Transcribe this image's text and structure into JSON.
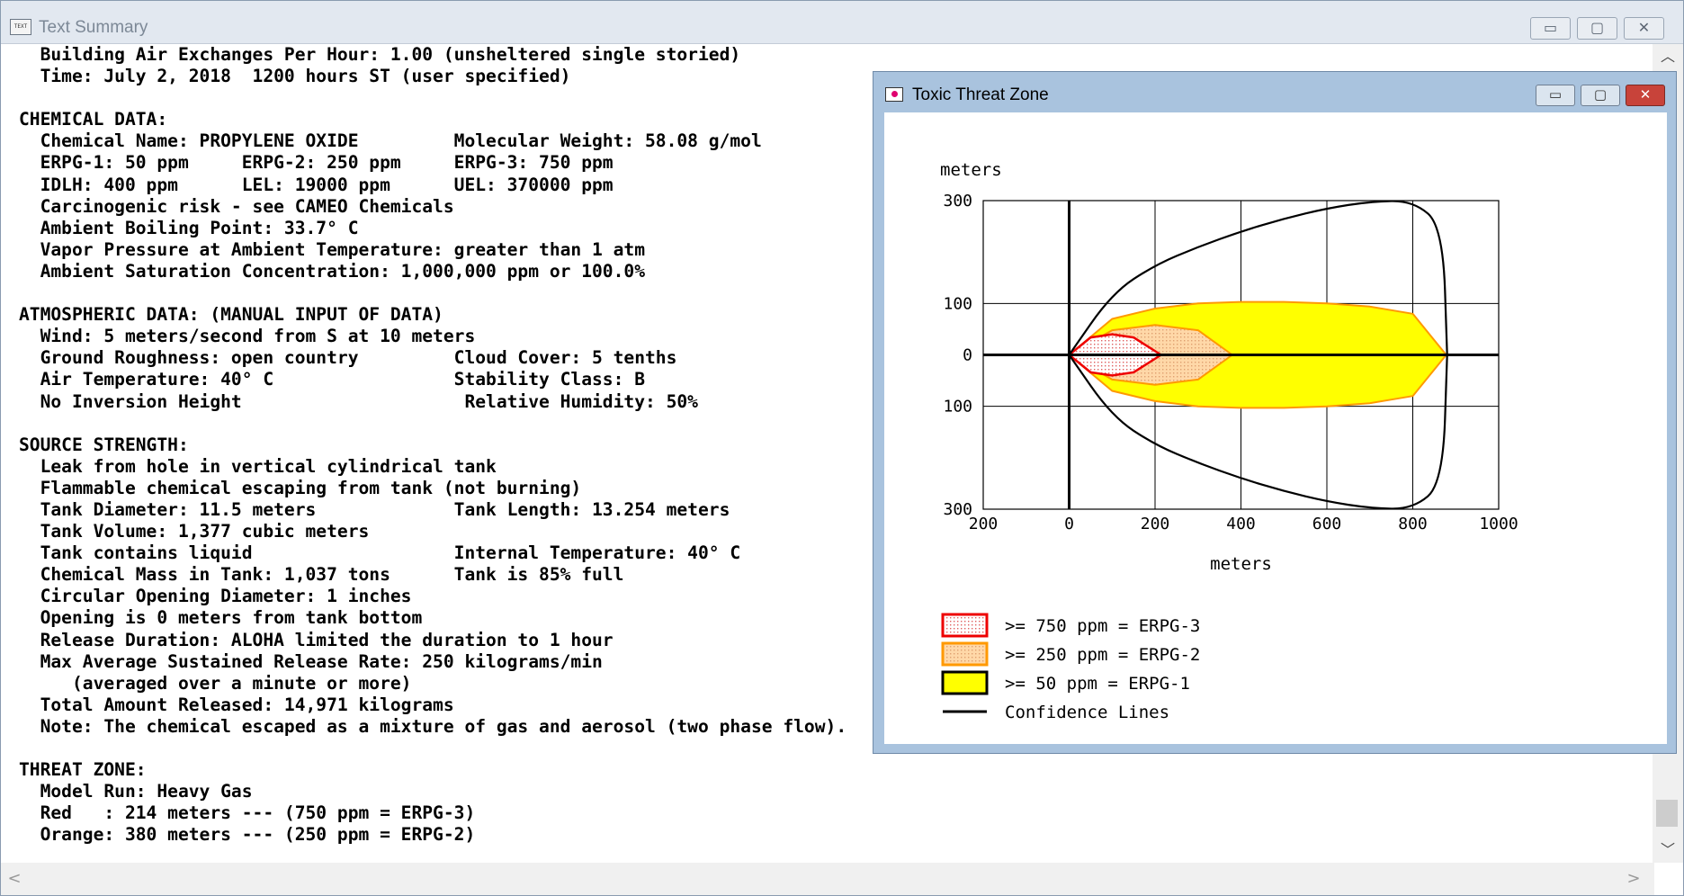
{
  "main_window": {
    "title": "Text Summary",
    "icon_label": "TEXT",
    "controls": {
      "minimize": "▭",
      "maximize": "▢",
      "close": "✕"
    },
    "lines": [
      "  Building Air Exchanges Per Hour: 1.00 (unsheltered single storied)",
      "  Time: July 2, 2018  1200 hours ST (user specified)",
      "",
      "CHEMICAL DATA:",
      "  Chemical Name: PROPYLENE OXIDE         Molecular Weight: 58.08 g/mol",
      "  ERPG-1: 50 ppm     ERPG-2: 250 ppm     ERPG-3: 750 ppm",
      "  IDLH: 400 ppm      LEL: 19000 ppm      UEL: 370000 ppm",
      "  Carcinogenic risk - see CAMEO Chemicals",
      "  Ambient Boiling Point: 33.7° C",
      "  Vapor Pressure at Ambient Temperature: greater than 1 atm",
      "  Ambient Saturation Concentration: 1,000,000 ppm or 100.0%",
      "",
      "ATMOSPHERIC DATA: (MANUAL INPUT OF DATA)",
      "  Wind: 5 meters/second from S at 10 meters",
      "  Ground Roughness: open country         Cloud Cover: 5 tenths",
      "  Air Temperature: 40° C                 Stability Class: B",
      "  No Inversion Height                     Relative Humidity: 50%",
      "",
      "SOURCE STRENGTH:",
      "  Leak from hole in vertical cylindrical tank",
      "  Flammable chemical escaping from tank (not burning)",
      "  Tank Diameter: 11.5 meters             Tank Length: 13.254 meters",
      "  Tank Volume: 1,377 cubic meters",
      "  Tank contains liquid                   Internal Temperature: 40° C",
      "  Chemical Mass in Tank: 1,037 tons      Tank is 85% full",
      "  Circular Opening Diameter: 1 inches",
      "  Opening is 0 meters from tank bottom",
      "  Release Duration: ALOHA limited the duration to 1 hour",
      "  Max Average Sustained Release Rate: 250 kilograms/min",
      "     (averaged over a minute or more)",
      "  Total Amount Released: 14,971 kilograms",
      "  Note: The chemical escaped as a mixture of gas and aerosol (two phase flow).",
      "",
      "THREAT ZONE:",
      "  Model Run: Heavy Gas",
      "  Red   : 214 meters --- (750 ppm = ERPG-3)",
      "  Orange: 380 meters --- (250 ppm = ERPG-2)"
    ]
  },
  "threat_window": {
    "title": "Toxic Threat Zone",
    "controls": {
      "minimize": "▭",
      "maximize": "▢",
      "close": "✕"
    }
  },
  "chart_data": {
    "type": "area",
    "ylabel": "meters",
    "xlabel": "meters",
    "x_ticks": [
      "200",
      "0",
      "200",
      "400",
      "600",
      "800",
      "1000"
    ],
    "y_ticks": [
      "300",
      "100",
      "0",
      "100",
      "300"
    ],
    "xlim": [
      -200,
      1000
    ],
    "ylim": [
      -300,
      300
    ],
    "grid": true,
    "legend_placement": "bottom-left",
    "series": [
      {
        "name": ">= 50 ppm = ERPG-1",
        "color": "#ffff00",
        "edge": "#ff9900",
        "x": [
          0,
          100,
          200,
          300,
          400,
          500,
          600,
          700,
          800,
          878
        ],
        "y_halfwidth": [
          0,
          70,
          90,
          100,
          103,
          103,
          100,
          94,
          80,
          0
        ]
      },
      {
        "name": ">= 250 ppm = ERPG-2",
        "color": "#ffd8a8",
        "edge": "#ff9900",
        "x": [
          0,
          100,
          200,
          300,
          380
        ],
        "y_halfwidth": [
          0,
          48,
          58,
          48,
          0
        ]
      },
      {
        "name": ">= 750 ppm = ERPG-3",
        "color": "#ffffff",
        "edge": "#ee0000",
        "x": [
          0,
          50,
          100,
          150,
          214
        ],
        "y_halfwidth": [
          0,
          34,
          40,
          34,
          0
        ]
      },
      {
        "name": "Confidence Lines",
        "color": "#000000",
        "x": [
          0,
          100,
          200,
          300,
          400,
          500,
          600,
          700,
          800,
          870,
          880
        ],
        "y_halfwidth": [
          0,
          120,
          175,
          210,
          240,
          265,
          285,
          298,
          300,
          250,
          0
        ]
      }
    ],
    "legend": [
      {
        "label": ">= 750 ppm = ERPG-3",
        "fill": "#ffe0e0",
        "stroke": "#ee0000",
        "hatch": true
      },
      {
        "label": ">= 250 ppm = ERPG-2",
        "fill": "#ffd8a8",
        "stroke": "#ff9900",
        "hatch": true
      },
      {
        "label": ">= 50 ppm = ERPG-1",
        "fill": "#ffff00",
        "stroke": "#000000",
        "hatch": false
      },
      {
        "label": "Confidence Lines",
        "line": true
      }
    ]
  }
}
